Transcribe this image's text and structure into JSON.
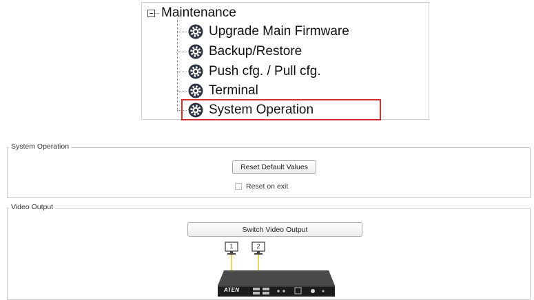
{
  "tree": {
    "root_label": "Maintenance",
    "items": [
      {
        "label": "Upgrade Main Firmware",
        "icon": "gear-icon"
      },
      {
        "label": "Backup/Restore",
        "icon": "gear-icon"
      },
      {
        "label": "Push cfg. / Pull cfg.",
        "icon": "gear-icon"
      },
      {
        "label": "Terminal",
        "icon": "gear-icon"
      },
      {
        "label": "System Operation",
        "icon": "gear-icon",
        "highlighted": true
      }
    ],
    "highlight_color": "#d32f2f"
  },
  "system_operation": {
    "legend": "System Operation",
    "reset_button": "Reset Default Values",
    "reset_on_exit_label": "Reset on exit",
    "reset_on_exit_checked": false
  },
  "video_output": {
    "legend": "Video Output",
    "switch_button": "Switch Video Output",
    "monitors": [
      "1",
      "2"
    ],
    "device_brand": "ATEN"
  }
}
